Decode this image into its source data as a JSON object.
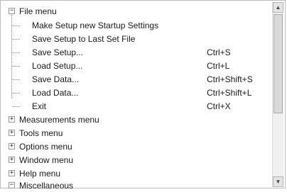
{
  "tree": {
    "file_menu": {
      "label": "File menu",
      "toggle": "−",
      "children": [
        {
          "label": "Make Setup new Startup Settings",
          "shortcut": ""
        },
        {
          "label": "Save Setup to Last Set File",
          "shortcut": ""
        },
        {
          "label": "Save Setup...",
          "shortcut": "Ctrl+S"
        },
        {
          "label": "Load Setup...",
          "shortcut": "Ctrl+L"
        },
        {
          "label": "Save Data...",
          "shortcut": "Ctrl+Shift+S"
        },
        {
          "label": "Load Data...",
          "shortcut": "Ctrl+Shift+L"
        },
        {
          "label": "Exit",
          "shortcut": "Ctrl+X"
        }
      ]
    },
    "menus": [
      {
        "label": "Measurements menu",
        "toggle": "+"
      },
      {
        "label": "Tools menu",
        "toggle": "+"
      },
      {
        "label": "Options menu",
        "toggle": "+"
      },
      {
        "label": "Window menu",
        "toggle": "+"
      },
      {
        "label": "Help menu",
        "toggle": "+"
      },
      {
        "label": "Miscellaneous",
        "toggle": "−"
      }
    ]
  },
  "scrollbar": {
    "up_icon": "▲",
    "down_icon": "▼"
  }
}
